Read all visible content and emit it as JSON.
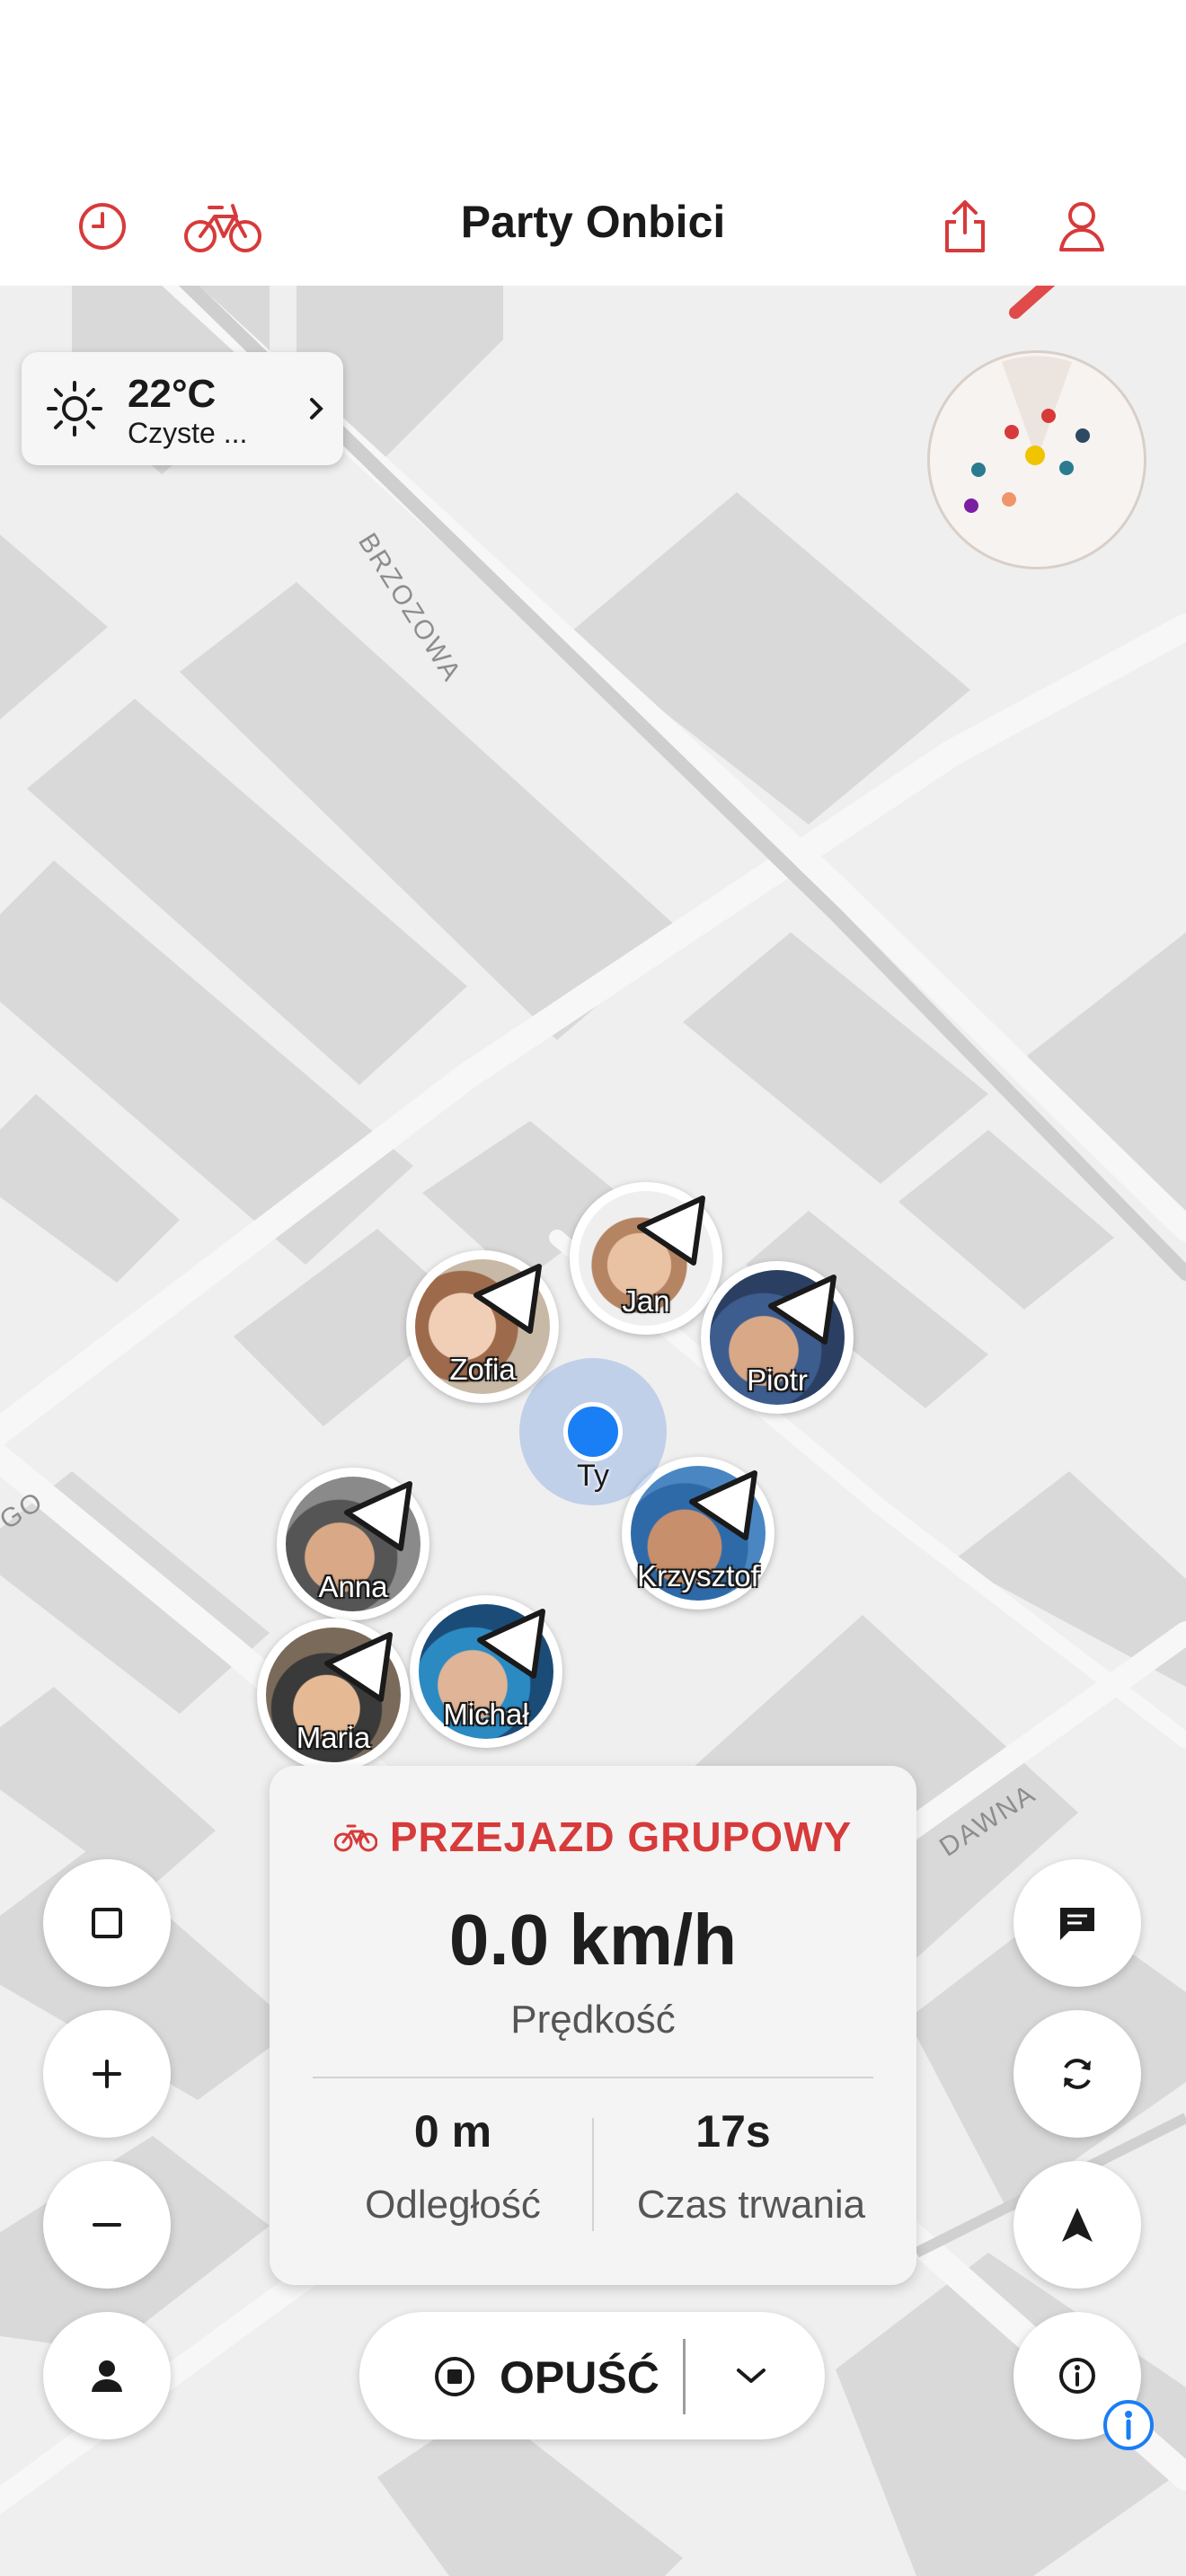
{
  "header": {
    "title": "Party Onbici",
    "icons": [
      "clock-icon",
      "bike-icon",
      "share-icon",
      "profile-icon"
    ]
  },
  "map": {
    "streets": [
      "BRZOZOWA",
      "DAWNA",
      "GO"
    ]
  },
  "weather": {
    "temperature": "22°C",
    "condition": "Czyste ..."
  },
  "riders": [
    {
      "name": "Jan"
    },
    {
      "name": "Zofia"
    },
    {
      "name": "Piotr"
    },
    {
      "name": "Krzysztof"
    },
    {
      "name": "Anna"
    },
    {
      "name": "Michał"
    },
    {
      "name": "Maria"
    }
  ],
  "me": {
    "label": "Ty"
  },
  "ride": {
    "mode": "PRZEJAZD GRUPOWY",
    "speed": "0.0 km/h",
    "speed_label": "Prędkość",
    "distance": "0 m",
    "distance_label": "Odległość",
    "duration": "17s",
    "duration_label": "Czas trwania"
  },
  "actions": {
    "leave_label": "OPUŚĆ"
  },
  "colors": {
    "accent": "#d73a3a",
    "location": "#1a7ef5",
    "map_bg": "#efefef",
    "building": "#d9d9d9"
  }
}
